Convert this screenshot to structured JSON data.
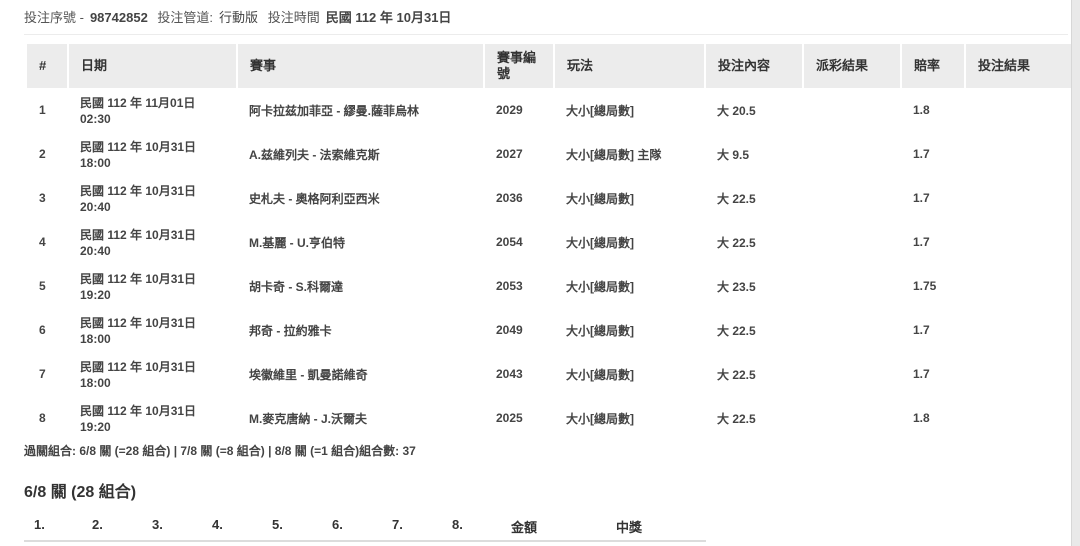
{
  "header": {
    "serial_label": "投注序號 -",
    "serial_value": "98742852",
    "channel_label": "投注管道:",
    "channel_value": "行動版",
    "time_label": "投注時間",
    "time_value": "民國 112 年 10月31日"
  },
  "table": {
    "columns": [
      "#",
      "日期",
      "賽事",
      "賽事編號",
      "玩法",
      "投注內容",
      "派彩結果",
      "賠率",
      "投注結果"
    ],
    "rows": [
      {
        "no": "1",
        "date": "民國 112 年 11月01日",
        "time": "02:30",
        "match": "阿卡拉兹加菲亞 - 繆曼.薩菲烏林",
        "code": "2029",
        "play": "大小[總局數]",
        "bet": "大 20.5",
        "payout": "",
        "odds": "1.8",
        "result": ""
      },
      {
        "no": "2",
        "date": "民國 112 年 10月31日",
        "time": "18:00",
        "match": "A.兹維列夫 - 法索維克斯",
        "code": "2027",
        "play": "大小[總局數] 主隊",
        "bet": "大 9.5",
        "payout": "",
        "odds": "1.7",
        "result": ""
      },
      {
        "no": "3",
        "date": "民國 112 年 10月31日",
        "time": "20:40",
        "match": "史札夫 - 奧格阿利亞西米",
        "code": "2036",
        "play": "大小[總局數]",
        "bet": "大 22.5",
        "payout": "",
        "odds": "1.7",
        "result": ""
      },
      {
        "no": "4",
        "date": "民國 112 年 10月31日",
        "time": "20:40",
        "match": "M.基麗 - U.亨伯特",
        "code": "2054",
        "play": "大小[總局數]",
        "bet": "大 22.5",
        "payout": "",
        "odds": "1.7",
        "result": ""
      },
      {
        "no": "5",
        "date": "民國 112 年 10月31日",
        "time": "19:20",
        "match": "胡卡奇 - S.科爾達",
        "code": "2053",
        "play": "大小[總局數]",
        "bet": "大 23.5",
        "payout": "",
        "odds": "1.75",
        "result": ""
      },
      {
        "no": "6",
        "date": "民國 112 年 10月31日",
        "time": "18:00",
        "match": "邦奇 - 拉約雅卡",
        "code": "2049",
        "play": "大小[總局數]",
        "bet": "大 22.5",
        "payout": "",
        "odds": "1.7",
        "result": ""
      },
      {
        "no": "7",
        "date": "民國 112 年 10月31日",
        "time": "18:00",
        "match": "埃徽維里 - 凱曼諾維奇",
        "code": "2043",
        "play": "大小[總局數]",
        "bet": "大 22.5",
        "payout": "",
        "odds": "1.7",
        "result": ""
      },
      {
        "no": "8",
        "date": "民國 112 年 10月31日",
        "time": "19:20",
        "match": "M.麥克唐納 - J.沃爾夫",
        "code": "2025",
        "play": "大小[總局數]",
        "bet": "大 22.5",
        "payout": "",
        "odds": "1.8",
        "result": ""
      }
    ]
  },
  "summary": "過關組合: 6/8 關 (=28 組合) | 7/8 關 (=8 組合) | 8/8 關 (=1 組合)組合數: 37",
  "section_title": "6/8 關 (28 組合)",
  "combo_columns": [
    "1.",
    "2.",
    "3.",
    "4.",
    "5.",
    "6.",
    "7.",
    "8.",
    "金額",
    "中獎"
  ]
}
